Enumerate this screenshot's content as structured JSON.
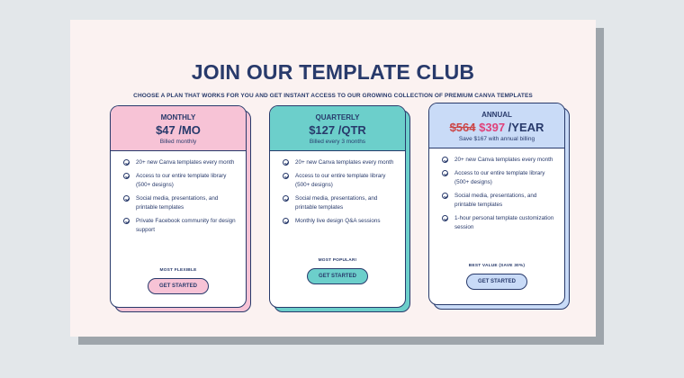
{
  "header": {
    "title": "JOIN OUR TEMPLATE CLUB",
    "subtitle": "CHOOSE A PLAN THAT WORKS FOR YOU AND GET INSTANT ACCESS TO OUR GROWING COLLECTION OF PREMIUM CANVA TEMPLATES"
  },
  "colors": {
    "navy": "#283a6b",
    "panel": "#fbf2f1",
    "monthly_accent": "#f7c3d6",
    "quarterly_accent": "#6ccfcb",
    "annual_accent": "#c9dbf7"
  },
  "plans": {
    "monthly": {
      "name": "MONTHLY",
      "price": "$47 /MO",
      "note": "Billed monthly",
      "features": [
        "20+ new Canva templates every month",
        "Access to our entire template library (500+ designs)",
        "Social media, presentations, and printable templates",
        "Private Facebook community for design support"
      ],
      "tag": "MOST FLEXIBLE",
      "cta": "GET STARTED"
    },
    "quarterly": {
      "name": "QUARTERLY",
      "price": "$127 /QTR",
      "note": "Billed every 3 months",
      "features": [
        "20+ new Canva templates every month",
        "Access to our entire template library (500+ designs)",
        "Social media, presentations, and printable templates",
        "Monthly live design Q&A sessions"
      ],
      "tag": "MOST POPULAR!",
      "cta": "GET STARTED"
    },
    "annual": {
      "name": "ANNUAL",
      "price_old": "$564",
      "price_new": "$397",
      "price_unit": "/YEAR",
      "note": "Save $167 with annual billing",
      "features": [
        "20+ new Canva templates every month",
        "Access to our entire template library (500+ designs)",
        "Social media, presentations, and printable templates",
        "1-hour personal template customization session"
      ],
      "tag": "BEST VALUE (SAVE 30%)",
      "cta": "GET STARTED"
    }
  }
}
